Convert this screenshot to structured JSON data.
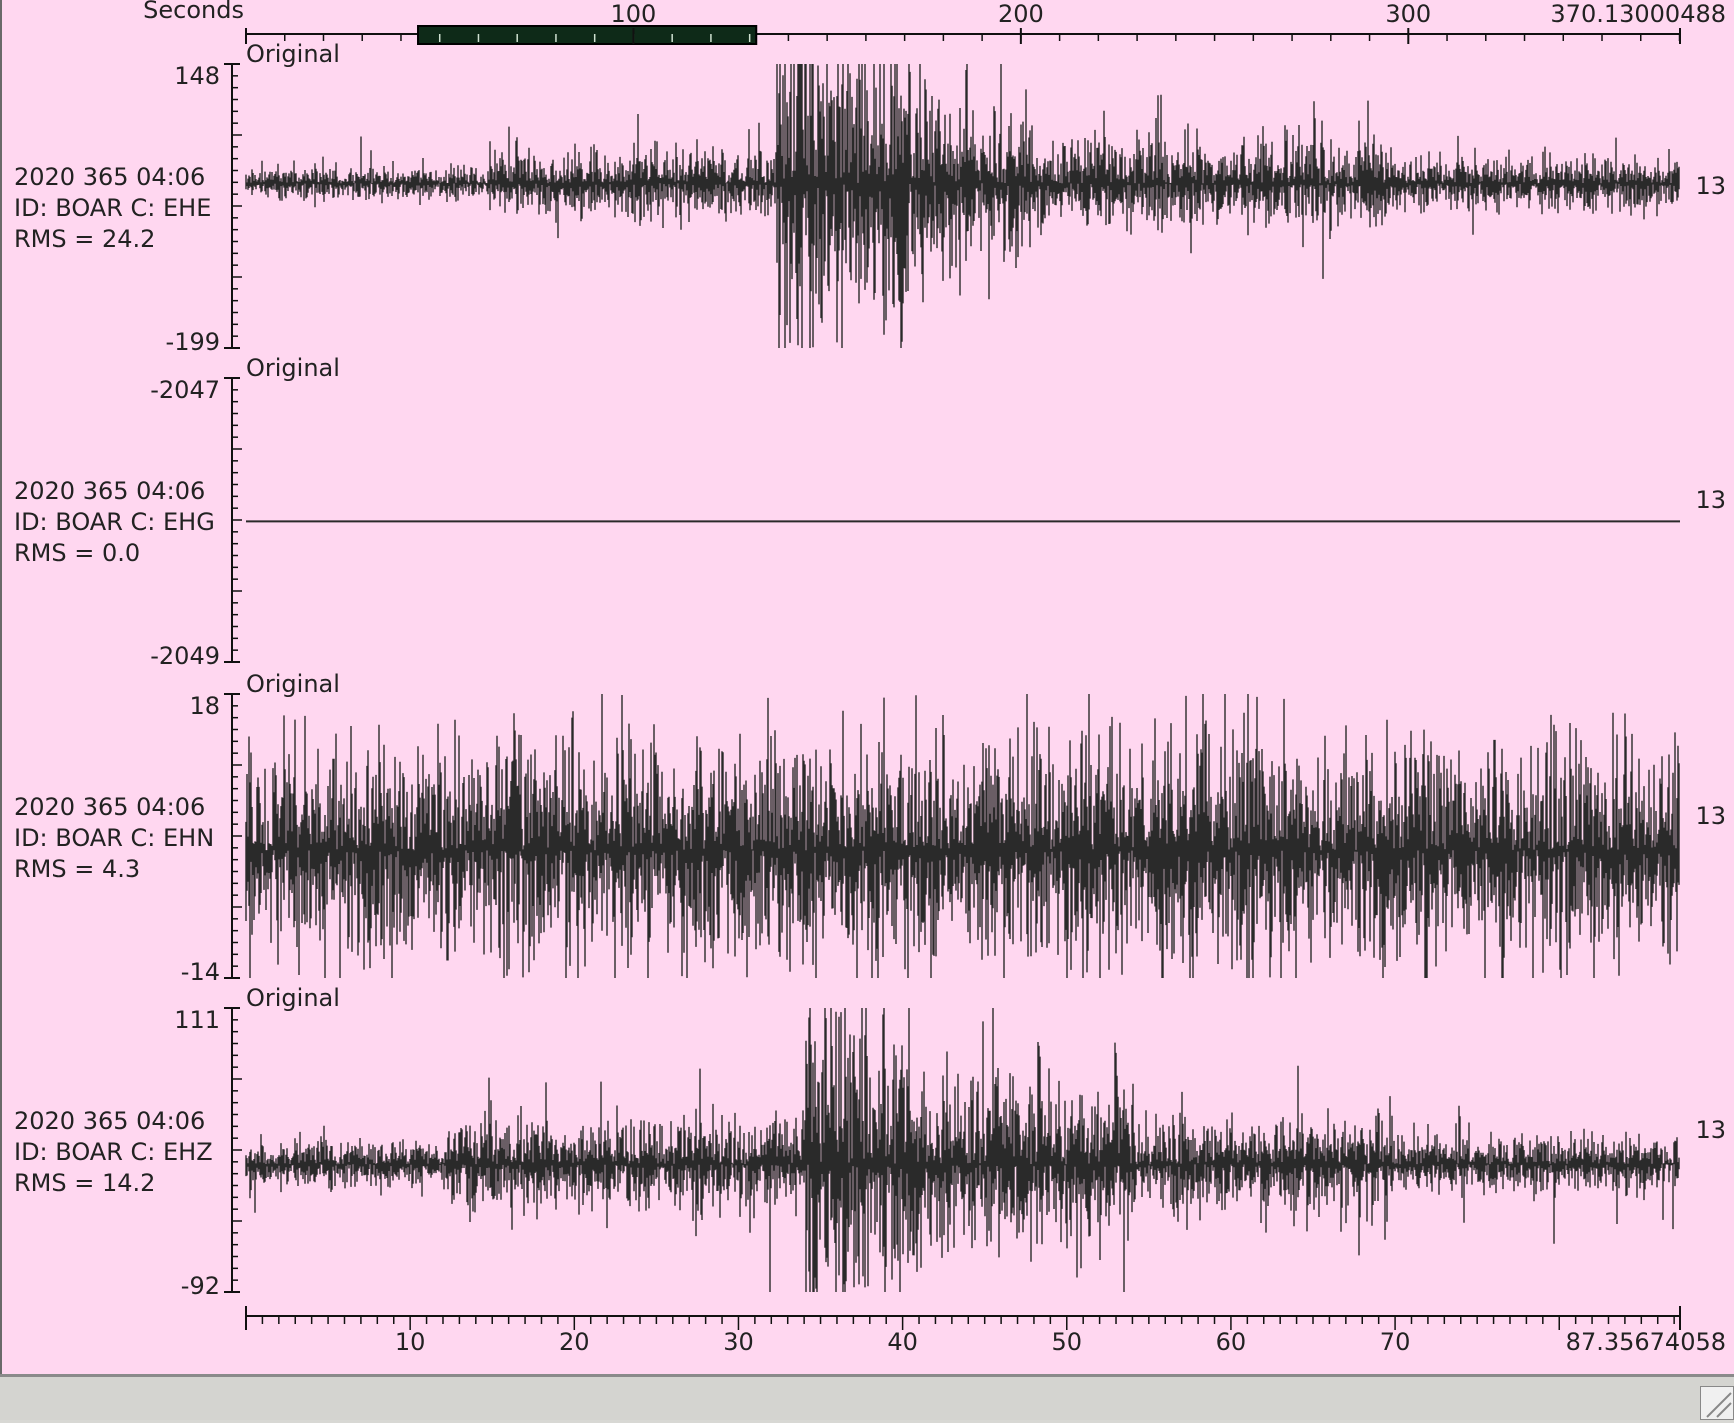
{
  "top_axis": {
    "unit_label": "Seconds",
    "ticks": [
      {
        "value": 100,
        "label": "100"
      },
      {
        "value": 200,
        "label": "200"
      },
      {
        "value": 300,
        "label": "300"
      }
    ],
    "end_label": "370.13000488",
    "range": [
      0,
      370.13000488
    ],
    "window_selection": {
      "start": 44.4,
      "end": 131.7
    }
  },
  "bottom_axis": {
    "ticks": [
      {
        "value": 10,
        "label": "10"
      },
      {
        "value": 20,
        "label": "20"
      },
      {
        "value": 30,
        "label": "30"
      },
      {
        "value": 40,
        "label": "40"
      },
      {
        "value": 50,
        "label": "50"
      },
      {
        "value": 60,
        "label": "60"
      },
      {
        "value": 70,
        "label": "70"
      }
    ],
    "end_label": "87.35674058",
    "range": [
      0,
      87.35674058
    ]
  },
  "traces": [
    {
      "mode": "Original",
      "time": "2020 365 04:06",
      "id": "ID: BOAR C: EHE",
      "rms": "RMS = 24.2",
      "ymax_label": "148",
      "ymin_label": "-199",
      "ymax": 148,
      "ymin": -199,
      "right_label": "13"
    },
    {
      "mode": "Original",
      "time": "2020 365 04:06",
      "id": "ID: BOAR C: EHG",
      "rms": "RMS = 0.0",
      "ymax_label": "-2047",
      "ymin_label": "-2049",
      "ymax": -2047,
      "ymin": -2049,
      "right_label": "13"
    },
    {
      "mode": "Original",
      "time": "2020 365 04:06",
      "id": "ID: BOAR C: EHN",
      "rms": "RMS = 4.3",
      "ymax_label": "18",
      "ymin_label": "-14",
      "ymax": 18,
      "ymin": -14,
      "right_label": "13"
    },
    {
      "mode": "Original",
      "time": "2020 365 04:06",
      "id": "ID: BOAR C: EHZ",
      "rms": "RMS = 14.2",
      "ymax_label": "111",
      "ymin_label": "-92",
      "ymax": 111,
      "ymin": -92,
      "right_label": "13"
    }
  ],
  "colors": {
    "background": "#ffd7f0",
    "trace": "#2a2a2a",
    "selection": "#0e2a18"
  }
}
